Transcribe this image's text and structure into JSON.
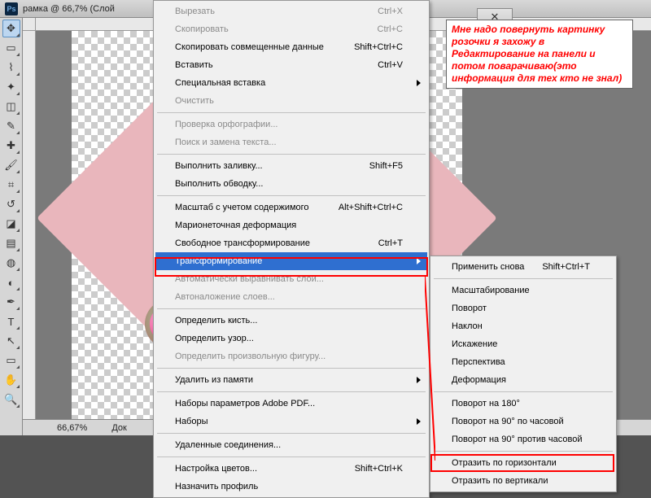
{
  "title": "рамка @ 66,7% (Слой",
  "statusbar": {
    "zoom": "66,67%",
    "doc": "Док"
  },
  "annotation": "Мне надо повернуть картинку розочки я захожу в Редактирование на панели и потом поварачиваю(это информация для тех кто не знал)",
  "menu1": [
    {
      "label": "Вырезать",
      "shortcut": "Ctrl+X",
      "disabled": true
    },
    {
      "label": "Скопировать",
      "shortcut": "Ctrl+C",
      "disabled": true
    },
    {
      "label": "Скопировать совмещенные данные",
      "shortcut": "Shift+Ctrl+C"
    },
    {
      "label": "Вставить",
      "shortcut": "Ctrl+V"
    },
    {
      "label": "Специальная вставка",
      "submenu": true
    },
    {
      "label": "Очистить",
      "disabled": true
    },
    {
      "sep": true
    },
    {
      "label": "Проверка орфографии...",
      "disabled": true
    },
    {
      "label": "Поиск и замена текста...",
      "disabled": true
    },
    {
      "sep": true
    },
    {
      "label": "Выполнить заливку...",
      "shortcut": "Shift+F5"
    },
    {
      "label": "Выполнить обводку..."
    },
    {
      "sep": true
    },
    {
      "label": "Масштаб с учетом содержимого",
      "shortcut": "Alt+Shift+Ctrl+C"
    },
    {
      "label": "Марионеточная деформация"
    },
    {
      "label": "Свободное трансформирование",
      "shortcut": "Ctrl+T"
    },
    {
      "label": "Трансформирование",
      "submenu": true,
      "highlight": true
    },
    {
      "label": "Автоматически выравнивать слои...",
      "disabled": true
    },
    {
      "label": "Автоналожение слоев...",
      "disabled": true
    },
    {
      "sep": true
    },
    {
      "label": "Определить кисть..."
    },
    {
      "label": "Определить узор..."
    },
    {
      "label": "Определить произвольную фигуру...",
      "disabled": true
    },
    {
      "sep": true
    },
    {
      "label": "Удалить из памяти",
      "submenu": true
    },
    {
      "sep": true
    },
    {
      "label": "Наборы параметров Adobe PDF..."
    },
    {
      "label": "Наборы",
      "submenu": true
    },
    {
      "sep": true
    },
    {
      "label": "Удаленные соединения..."
    },
    {
      "sep": true
    },
    {
      "label": "Настройка цветов...",
      "shortcut": "Shift+Ctrl+K"
    },
    {
      "label": "Назначить профиль"
    }
  ],
  "menu2": [
    {
      "label": "Применить снова",
      "shortcut": "Shift+Ctrl+T"
    },
    {
      "sep": true
    },
    {
      "label": "Масштабирование"
    },
    {
      "label": "Поворот"
    },
    {
      "label": "Наклон"
    },
    {
      "label": "Искажение"
    },
    {
      "label": "Перспектива"
    },
    {
      "label": "Деформация"
    },
    {
      "sep": true
    },
    {
      "label": "Поворот на 180°"
    },
    {
      "label": "Поворот на 90° по часовой"
    },
    {
      "label": "Поворот на 90° против часовой"
    },
    {
      "sep": true
    },
    {
      "label": "Отразить по горизонтали"
    },
    {
      "label": "Отразить по вертикали"
    }
  ],
  "tools": [
    "move",
    "marquee",
    "lasso",
    "wand",
    "crop",
    "eyedropper",
    "healing",
    "brush",
    "stamp",
    "history",
    "eraser",
    "gradient",
    "blur",
    "dodge",
    "pen",
    "type",
    "path",
    "rect",
    "hand",
    "zoom"
  ]
}
